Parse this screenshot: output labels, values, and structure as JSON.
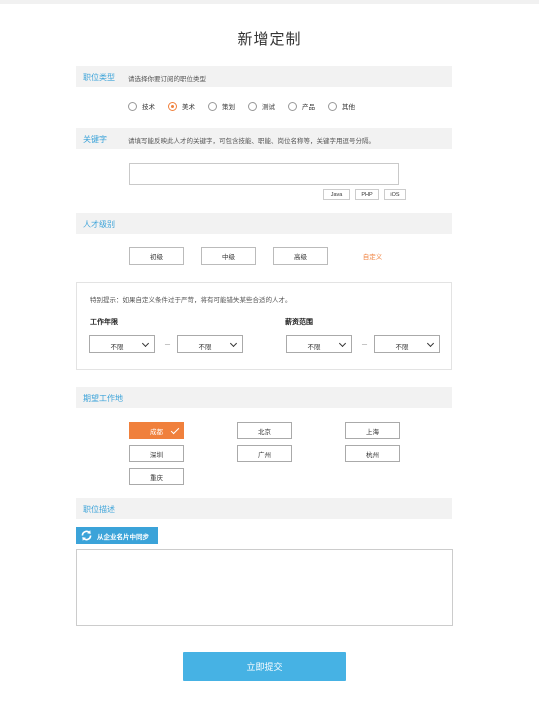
{
  "page_title": "新增定制",
  "job_type": {
    "title": "职位类型",
    "hint": "请选择你要订阅的职位类型",
    "options": [
      "技术",
      "美术",
      "策划",
      "测试",
      "产品",
      "其他"
    ],
    "selected": "美术"
  },
  "keywords": {
    "title": "关键字",
    "hint": "请填写能反映此人才的关键字，可包含技能、职能、岗位名称等，关键字用逗号分隔。",
    "input_value": "",
    "tags": [
      "Java",
      "PHP",
      "iOS"
    ]
  },
  "talent_level": {
    "title": "人才级别",
    "levels": [
      "初级",
      "中级",
      "高级",
      "自定义"
    ],
    "selected": "自定义",
    "custom": {
      "tip": "特别提示：如果自定义条件过于严苛，将有可能错失某些合适的人才。",
      "work_years_label": "工作年限",
      "salary_label": "薪资范围",
      "work_years_min": "不限",
      "work_years_max": "不限",
      "salary_min": "不限",
      "salary_max": "不限",
      "separator": "－"
    }
  },
  "location": {
    "title": "期望工作地",
    "cities": [
      "成都",
      "北京",
      "上海",
      "深圳",
      "广州",
      "杭州",
      "重庆"
    ],
    "selected": "成都"
  },
  "description": {
    "title": "职位描述",
    "sync_label": "从企业名片中同步",
    "value": ""
  },
  "submit_label": "立即提交",
  "colors": {
    "accent_blue": "#3ba3d9",
    "accent_orange": "#f0803c",
    "submit_blue": "#46b2e4",
    "section_bg": "#f2f2f2"
  },
  "icons": {
    "sync": "refresh-icon",
    "selected_city": "checkmark-icon",
    "dropdown": "chevron-down-icon",
    "radio": "radio-icon"
  }
}
